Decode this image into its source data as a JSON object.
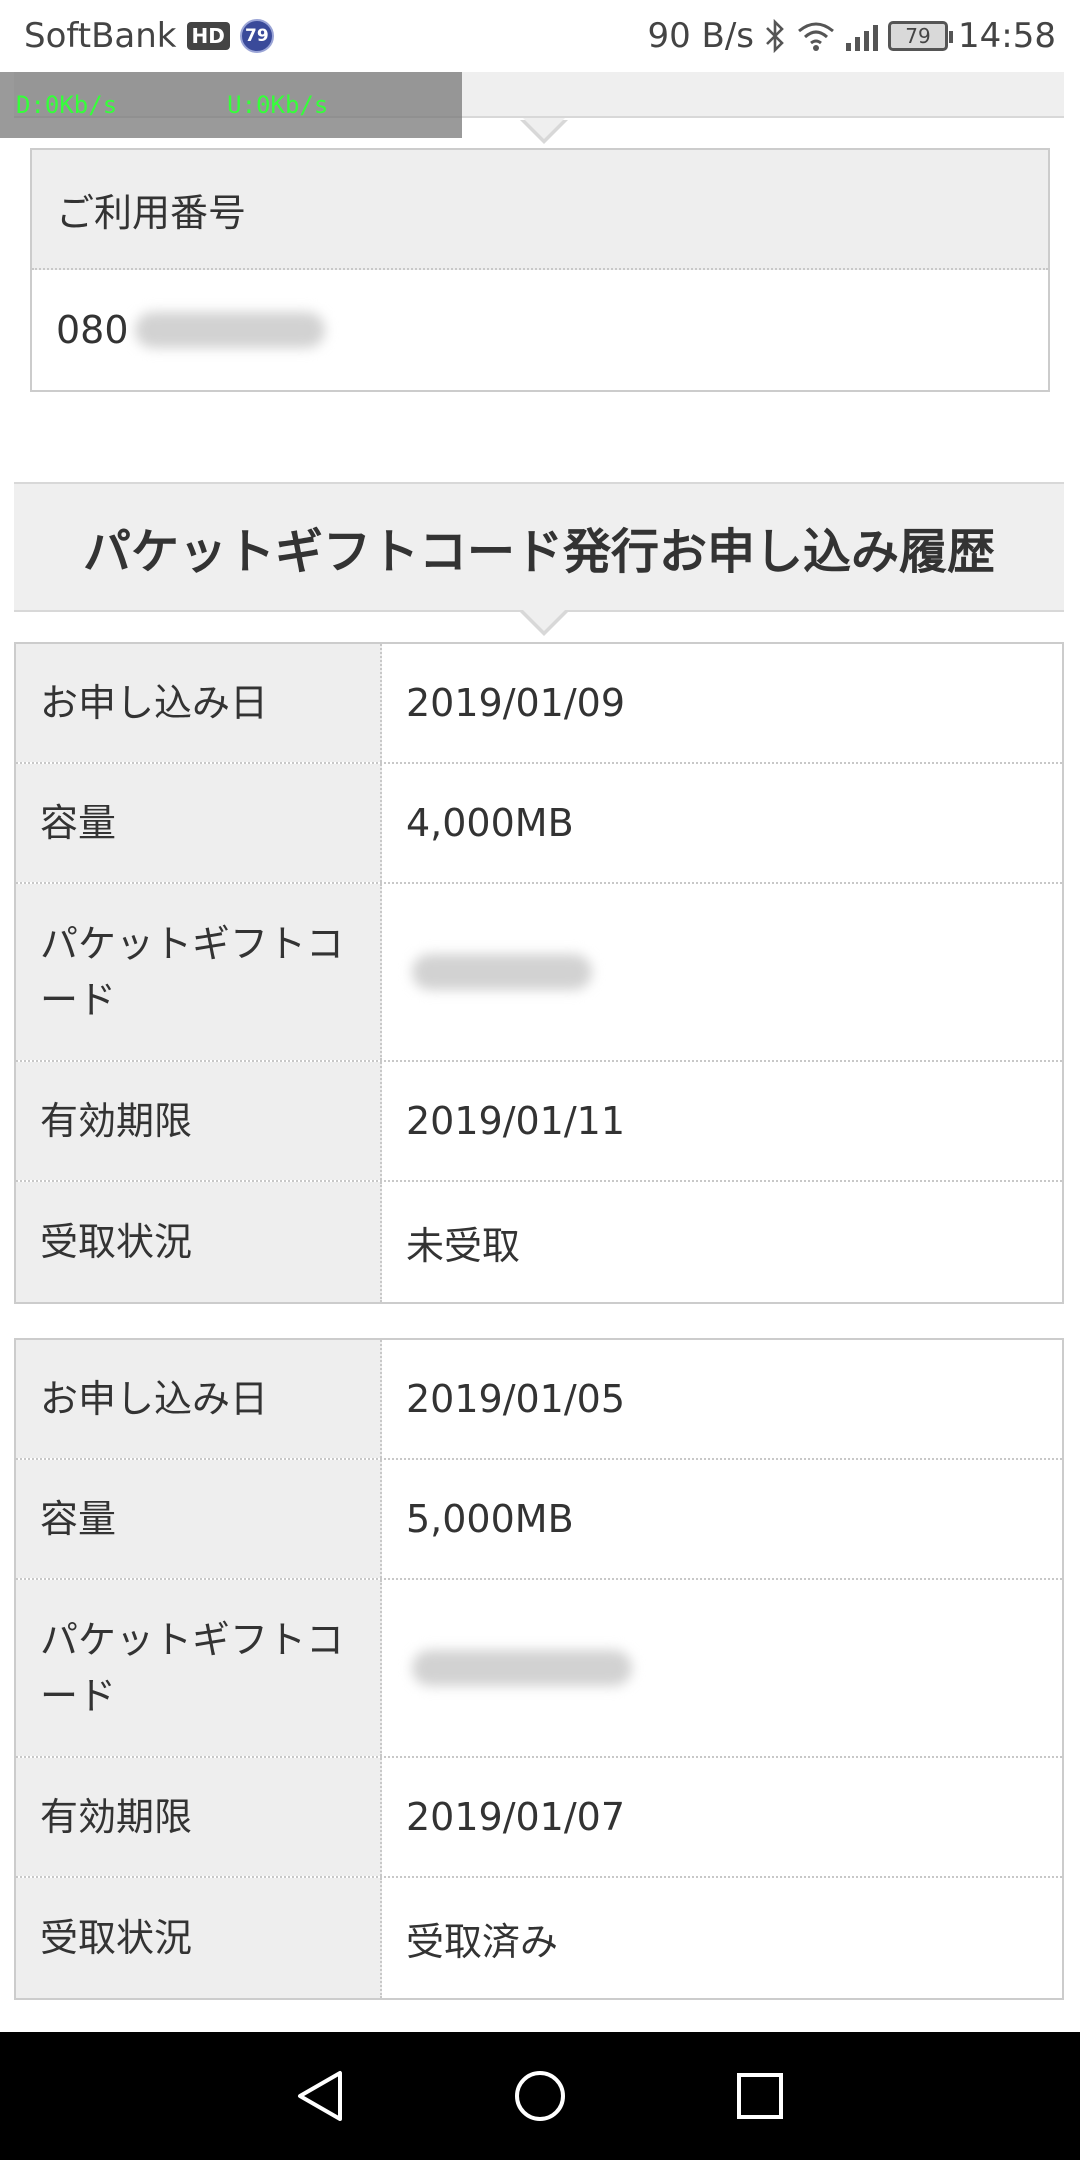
{
  "status_bar": {
    "carrier": "SoftBank",
    "hd_label": "HD",
    "badge_number": "79",
    "net_speed": "90 B/s",
    "battery": "79",
    "time": "14:58",
    "icons": [
      "bluetooth-icon",
      "wifi-icon",
      "signal-icon",
      "battery-icon"
    ]
  },
  "net_overlay": {
    "download": "D:0Kb/s",
    "upload": "U:0Kb/s"
  },
  "top_section": {
    "label": "ご利用番号",
    "number_prefix": "080"
  },
  "history": {
    "title": "パケットギフトコード発行お申し込み履歴",
    "records": [
      {
        "rows": [
          {
            "key": "お申し込み日",
            "value": "2019/01/09"
          },
          {
            "key": "容量",
            "value": "4,000MB"
          },
          {
            "key": "パケットギフトコード",
            "value": ""
          },
          {
            "key": "有効期限",
            "value": "2019/01/11"
          },
          {
            "key": "受取状況",
            "value": "未受取"
          }
        ]
      },
      {
        "rows": [
          {
            "key": "お申し込み日",
            "value": "2019/01/05"
          },
          {
            "key": "容量",
            "value": "5,000MB"
          },
          {
            "key": "パケットギフトコード",
            "value": ""
          },
          {
            "key": "有効期限",
            "value": "2019/01/07"
          },
          {
            "key": "受取状況",
            "value": "受取済み"
          }
        ]
      }
    ]
  },
  "nav": {
    "buttons": [
      "back-icon",
      "home-icon",
      "recents-icon"
    ]
  }
}
